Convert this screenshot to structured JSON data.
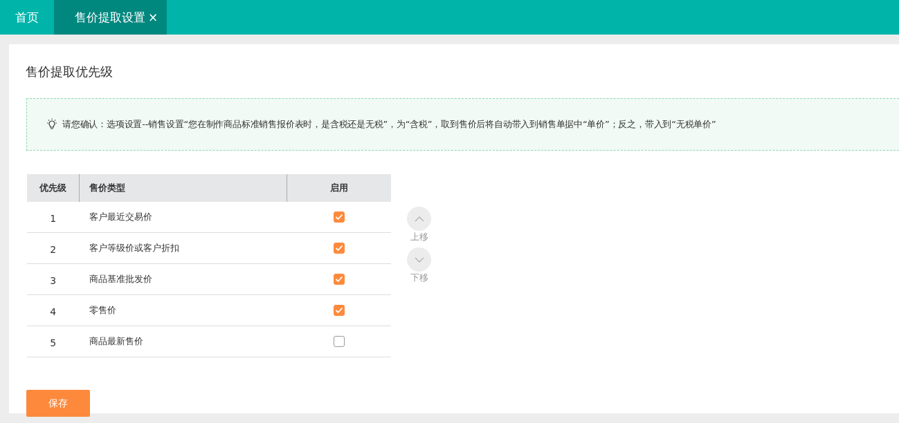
{
  "tabs": [
    {
      "label": "首页",
      "selected": false
    },
    {
      "label": "售价提取设置",
      "selected": true,
      "close": "×"
    }
  ],
  "title": "售价提取优先级",
  "tip": "请您确认：选项设置--销售设置“您在制作商品标准销售报价表时，是含税还是无税”，为“含税”，取到售价后将自动带入到销售单据中“单价”；反之，带入到“无税单价”",
  "table": {
    "columns": [
      "优先级",
      "售价类型",
      "启用"
    ],
    "rows": [
      {
        "priority": "1",
        "type": "客户最近交易价",
        "enabled": true
      },
      {
        "priority": "2",
        "type": "客户等级价或客户折扣",
        "enabled": true
      },
      {
        "priority": "3",
        "type": "商品基准批发价",
        "enabled": true
      },
      {
        "priority": "4",
        "type": "零售价",
        "enabled": true
      },
      {
        "priority": "5",
        "type": "商品最新售价",
        "enabled": false
      }
    ]
  },
  "move_buttons": [
    {
      "kind": "up",
      "label": "上移"
    },
    {
      "kind": "down",
      "label": "下移"
    }
  ],
  "save_button": "保存"
}
